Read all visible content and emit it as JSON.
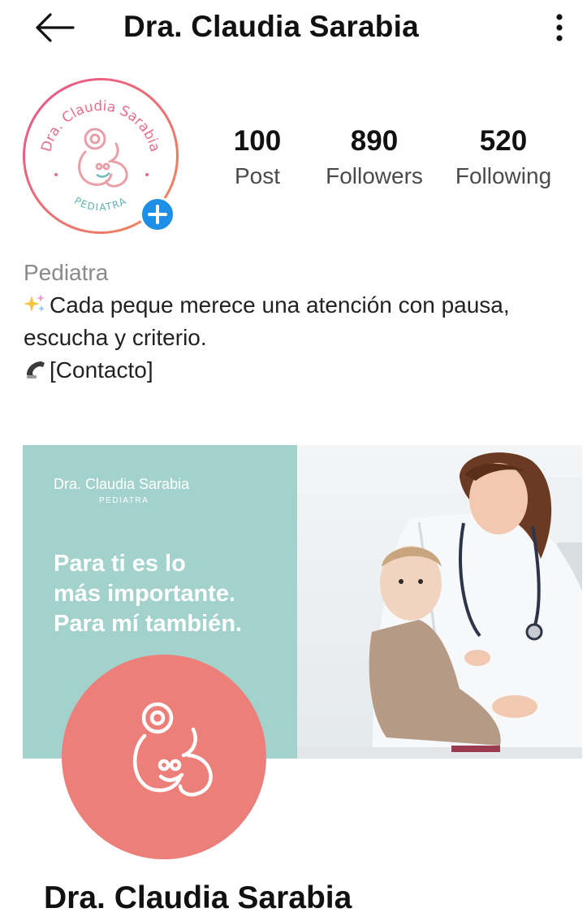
{
  "header": {
    "title": "Dra. Claudia Sarabia",
    "back_icon": "arrow-left-icon",
    "more_icon": "more-vertical-icon"
  },
  "profile": {
    "avatar_texts": {
      "top": "Dra. Claudia Sarabia",
      "bottom": "PEDIATRA"
    },
    "add_icon": "plus-icon",
    "stats": [
      {
        "value": "100",
        "label": "Post"
      },
      {
        "value": "890",
        "label": "Followers"
      },
      {
        "value": "520",
        "label": "Following"
      }
    ]
  },
  "bio": {
    "category": "Pediatra",
    "line1": "Cada peque merece una atención con pausa,",
    "line2": "escucha y criterio.",
    "line3": "[Contacto]",
    "icons": [
      "sparkles-icon",
      "phone-icon"
    ]
  },
  "post": {
    "brand_name": "Dra. Claudia Sarabia",
    "brand_sub": "PEDIATRA",
    "tagline": [
      "Para ti es lo",
      "más importante.",
      "Para mí también."
    ],
    "display_name": "Dra. Claudia Sarabia"
  },
  "colors": {
    "accent_blue": "#1d8fe6",
    "teal_panel": "#a2d2cb",
    "coral": "#ed7f7a",
    "avatar_ring_start": "#e8548f",
    "avatar_ring_end": "#ee8a5a"
  }
}
